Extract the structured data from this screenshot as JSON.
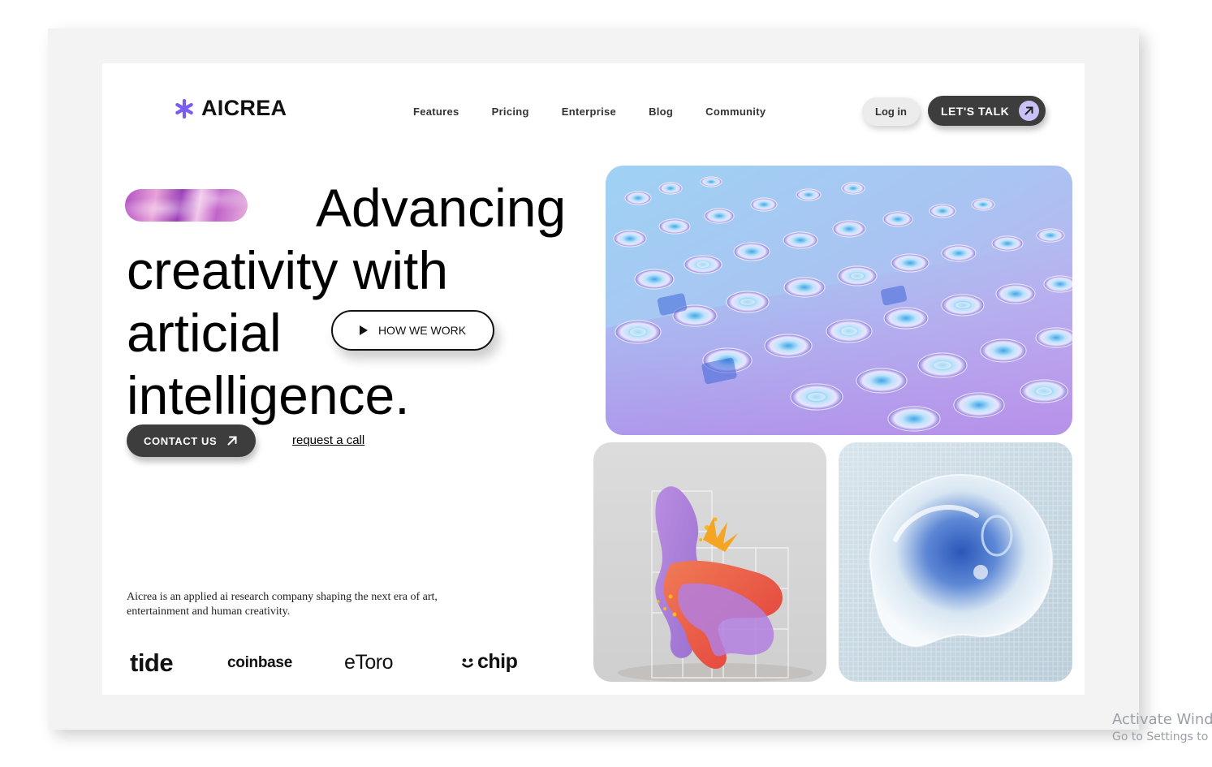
{
  "brand": {
    "name": "AICREA",
    "accent": "#7b5cf0"
  },
  "nav": {
    "items": [
      {
        "label": "Features"
      },
      {
        "label": "Pricing"
      },
      {
        "label": "Enterprise"
      },
      {
        "label": "Blog"
      },
      {
        "label": "Community"
      }
    ]
  },
  "header": {
    "login_label": "Log in",
    "cta_label": "LET'S TALK"
  },
  "hero": {
    "line1": "Advancing",
    "line2": "creativity with",
    "line3": "articial",
    "line4": "intelligence.",
    "how_label": "HOW WE WORK",
    "contact_label": "CONTACT US",
    "request_label": "request a call",
    "description": "Aicrea is an applied ai research company shaping the next era of art, entertainment and human creativity."
  },
  "partners": [
    "tide",
    "coinbase",
    "eToro",
    "chip"
  ],
  "colors": {
    "dark_button": "#3d3d3d",
    "arrow_circle": "#c9c2f6",
    "frame_bg": "#f3f3f3"
  },
  "watermark": {
    "line1": "Activate Wind",
    "line2": "Go to Settings to a"
  }
}
